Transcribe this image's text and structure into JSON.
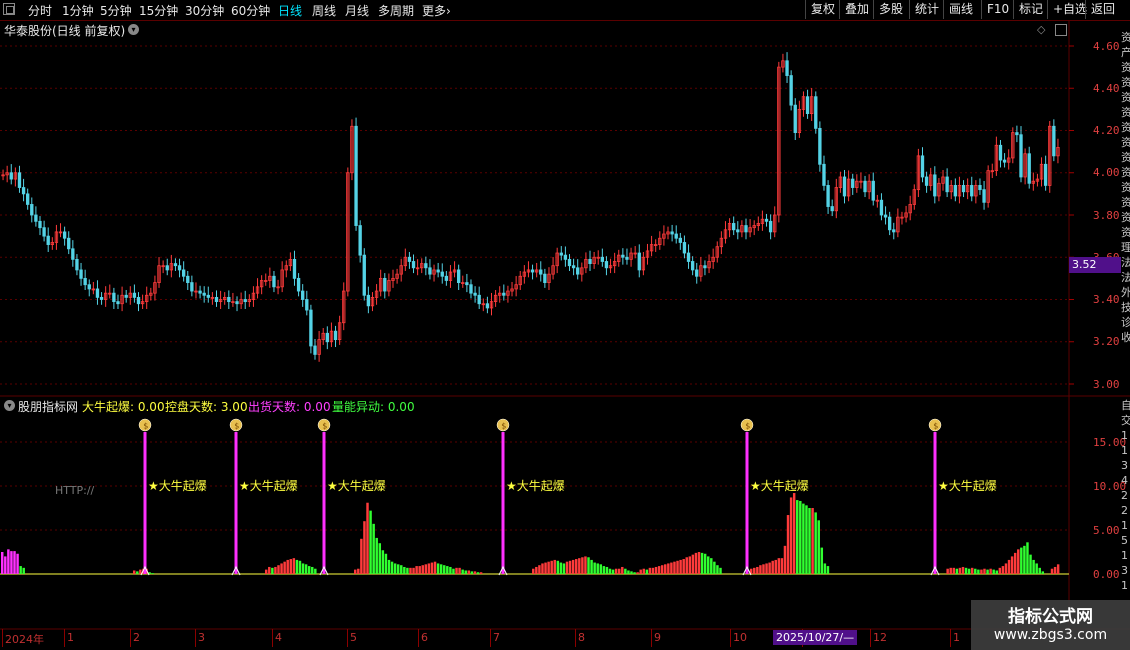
{
  "toolbar": {
    "periods": [
      {
        "label": "分时",
        "active": false
      },
      {
        "label": "1分钟",
        "active": false
      },
      {
        "label": "5分钟",
        "active": false
      },
      {
        "label": "15分钟",
        "active": false
      },
      {
        "label": "30分钟",
        "active": false
      },
      {
        "label": "60分钟",
        "active": false
      },
      {
        "label": "日线",
        "active": true
      },
      {
        "label": "周线",
        "active": false
      },
      {
        "label": "月线",
        "active": false
      },
      {
        "label": "多周期",
        "active": false
      },
      {
        "label": "更多",
        "active": false
      }
    ],
    "more_chevron": "›",
    "right_buttons": [
      "复权",
      "叠加",
      "多股",
      "统计",
      "画线",
      "F10",
      "标记",
      "+自选",
      "返回"
    ]
  },
  "main_chart": {
    "title": "华泰股份(日线 前复权)",
    "y_ticks": [
      "4.60",
      "4.40",
      "4.20",
      "4.00",
      "3.80",
      "3.60",
      "3.40",
      "3.20",
      "3.00"
    ],
    "current_price": "3.52"
  },
  "indicator": {
    "name": "股朋指标网",
    "values": [
      {
        "label": "大牛起爆: 0.00",
        "color": "#ffff40"
      },
      {
        "label": "控盘天数: 3.00",
        "color": "#ffff40"
      },
      {
        "label": "出货天数: 0.00",
        "color": "#ff40ff"
      },
      {
        "label": "量能异动: 0.00",
        "color": "#40ff40"
      }
    ],
    "y_ticks": [
      "15.00",
      "10.00",
      "5.00",
      "0.00"
    ],
    "signal_label": "★大牛起爆",
    "http_text": "HTTP://"
  },
  "x_axis": {
    "labels": [
      "2024年",
      "1",
      "2",
      "3",
      "4",
      "5",
      "6",
      "7",
      "8",
      "9",
      "10",
      "11",
      "12",
      "1"
    ],
    "date_tag": "2025/10/27/—"
  },
  "watermark": {
    "line1": "指标公式网",
    "line2": "www.zbgs3.com"
  },
  "colors": {
    "up": "#ff3b3b",
    "down": "#54d3e6",
    "grid": "#5a0000",
    "magenta": "#ff30ff",
    "green": "#30ff30",
    "yellow": "#ffff40"
  },
  "chart_data": [
    {
      "type": "candlestick",
      "title": "华泰股份(日线 前复权)",
      "ylim": [
        2.95,
        4.7
      ],
      "close": [
        3.99,
        4.0,
        3.97,
        4.0,
        3.93,
        3.9,
        3.85,
        3.8,
        3.77,
        3.74,
        3.7,
        3.66,
        3.67,
        3.72,
        3.72,
        3.69,
        3.64,
        3.59,
        3.54,
        3.5,
        3.47,
        3.45,
        3.45,
        3.41,
        3.4,
        3.43,
        3.43,
        3.39,
        3.38,
        3.42,
        3.41,
        3.43,
        3.41,
        3.38,
        3.39,
        3.42,
        3.43,
        3.48,
        3.56,
        3.56,
        3.54,
        3.57,
        3.56,
        3.54,
        3.51,
        3.48,
        3.44,
        3.44,
        3.43,
        3.42,
        3.41,
        3.41,
        3.39,
        3.4,
        3.41,
        3.39,
        3.39,
        3.38,
        3.4,
        3.39,
        3.4,
        3.43,
        3.46,
        3.49,
        3.49,
        3.51,
        3.46,
        3.46,
        3.54,
        3.56,
        3.59,
        3.5,
        3.44,
        3.4,
        3.35,
        3.18,
        3.14,
        3.21,
        3.24,
        3.2,
        3.25,
        3.21,
        3.29,
        3.44,
        4.0,
        4.22,
        3.75,
        3.61,
        3.42,
        3.37,
        3.41,
        3.44,
        3.5,
        3.44,
        3.49,
        3.5,
        3.52,
        3.56,
        3.6,
        3.58,
        3.55,
        3.55,
        3.57,
        3.55,
        3.52,
        3.54,
        3.53,
        3.51,
        3.49,
        3.53,
        3.54,
        3.48,
        3.48,
        3.47,
        3.43,
        3.42,
        3.38,
        3.38,
        3.36,
        3.39,
        3.42,
        3.43,
        3.42,
        3.44,
        3.45,
        3.47,
        3.51,
        3.53,
        3.54,
        3.53,
        3.54,
        3.52,
        3.48,
        3.52,
        3.56,
        3.62,
        3.61,
        3.59,
        3.56,
        3.55,
        3.52,
        3.55,
        3.59,
        3.57,
        3.6,
        3.6,
        3.58,
        3.55,
        3.56,
        3.58,
        3.61,
        3.6,
        3.59,
        3.62,
        3.62,
        3.54,
        3.6,
        3.63,
        3.66,
        3.66,
        3.69,
        3.71,
        3.72,
        3.71,
        3.69,
        3.67,
        3.62,
        3.58,
        3.54,
        3.51,
        3.56,
        3.55,
        3.58,
        3.6,
        3.65,
        3.69,
        3.73,
        3.76,
        3.73,
        3.72,
        3.75,
        3.72,
        3.74,
        3.75,
        3.76,
        3.78,
        3.77,
        3.72,
        3.8,
        4.5,
        4.53,
        4.46,
        4.32,
        4.19,
        4.3,
        4.36,
        4.28,
        4.36,
        4.21,
        4.04,
        3.94,
        3.84,
        3.82,
        3.93,
        3.98,
        3.89,
        3.97,
        3.93,
        3.96,
        3.96,
        3.91,
        3.96,
        3.87,
        3.87,
        3.8,
        3.79,
        3.73,
        3.72,
        3.79,
        3.79,
        3.81,
        3.85,
        3.92,
        4.08,
        3.98,
        3.94,
        3.99,
        3.89,
        3.95,
        3.98,
        3.91,
        3.94,
        3.89,
        3.94,
        3.91,
        3.94,
        3.89,
        3.94,
        3.92,
        3.86,
        4.01,
        4.01,
        4.13,
        4.06,
        4.05,
        4.07,
        4.19,
        4.18,
        3.98,
        4.09,
        3.95,
        3.96,
        3.97,
        4.04,
        3.94,
        4.22,
        4.08,
        4.12
      ],
      "yaxis_ticks": [
        4.6,
        4.4,
        4.2,
        4.0,
        3.8,
        3.6,
        3.4,
        3.2,
        3.0
      ]
    },
    {
      "type": "bar",
      "title": "股朋指标网",
      "ylim": [
        0,
        19
      ],
      "values": [
        2.5,
        2.0,
        2.8,
        2.6,
        2.6,
        2.3,
        0.9,
        0.7,
        0,
        0,
        0,
        0,
        0,
        0,
        0,
        0,
        0,
        0,
        0,
        0,
        0,
        0,
        0,
        0,
        0,
        0,
        0,
        0,
        0,
        0,
        0,
        0,
        0,
        0,
        0,
        0,
        0,
        0,
        0,
        0,
        0,
        0,
        0,
        0.4,
        0.3,
        0.5,
        0.6,
        0.6,
        0.2,
        0.1,
        0,
        0,
        0,
        0,
        0,
        0,
        0,
        0,
        0,
        0,
        0,
        0,
        0,
        0,
        0,
        0,
        0,
        0,
        0,
        0,
        0,
        0,
        0,
        0,
        0,
        0,
        0,
        0,
        0,
        0,
        0,
        0,
        0,
        0,
        0,
        0,
        0.5,
        0.8,
        0.7,
        0.8,
        1.0,
        1.2,
        1.4,
        1.6,
        1.7,
        1.8,
        1.6,
        1.5,
        1.2,
        1.1,
        0.9,
        0.8,
        0.6,
        0,
        0,
        0,
        0,
        0,
        0,
        0,
        0,
        0,
        0,
        0,
        0,
        0.5,
        0.6,
        4.0,
        6.0,
        8.1,
        7.2,
        5.7,
        4.1,
        3.5,
        2.7,
        2.3,
        1.6,
        1.4,
        1.2,
        1.1,
        1.0,
        0.8,
        0.7,
        0.7,
        0.7,
        0.9,
        0.9,
        1.0,
        1.1,
        1.2,
        1.3,
        1.4,
        1.2,
        1.1,
        1.0,
        0.9,
        0.8,
        0.6,
        0.7,
        0.7,
        0.5,
        0.4,
        0.4,
        0.3,
        0.3,
        0.2,
        0.2,
        0,
        0,
        0,
        0,
        0,
        0,
        0,
        0,
        0,
        0,
        0,
        0,
        0,
        0,
        0,
        0,
        0.6,
        0.8,
        1.0,
        1.2,
        1.3,
        1.4,
        1.5,
        1.6,
        1.5,
        1.3,
        1.2,
        1.4,
        1.5,
        1.6,
        1.7,
        1.8,
        1.9,
        2.0,
        1.9,
        1.6,
        1.3,
        1.2,
        1.1,
        0.9,
        0.8,
        0.6,
        0.5,
        0.6,
        0.6,
        0.8,
        0.6,
        0.4,
        0.3,
        0.2,
        0.2,
        0.5,
        0.6,
        0.5,
        0.7,
        0.7,
        0.8,
        0.9,
        1.0,
        1.1,
        1.2,
        1.3,
        1.4,
        1.5,
        1.6,
        1.7,
        1.9,
        2.0,
        2.2,
        2.4,
        2.5,
        2.4,
        2.3,
        2.0,
        1.8,
        1.4,
        1.0,
        0.7,
        0,
        0,
        0,
        0,
        0,
        0,
        0,
        0,
        0,
        0.6,
        0.7,
        0.8,
        1.0,
        1.1,
        1.2,
        1.3,
        1.5,
        1.6,
        1.8,
        1.8,
        3.2,
        6.7,
        8.7,
        9.2,
        8.4,
        8.3,
        8.0,
        7.8,
        7.5,
        7.5,
        7.0,
        6.1,
        3.0,
        1.2,
        0.9,
        0,
        0,
        0,
        0,
        0,
        0,
        0,
        0,
        0,
        0,
        0,
        0,
        0,
        0,
        0,
        0,
        0,
        0,
        0,
        0,
        0,
        0,
        0,
        0,
        0,
        0,
        0,
        0,
        0,
        0,
        0,
        0,
        0,
        0,
        0,
        0,
        0,
        0,
        0.6,
        0.7,
        0.7,
        0.6,
        0.7,
        0.8,
        0.7,
        0.6,
        0.7,
        0.6,
        0.5,
        0.5,
        0.6,
        0.5,
        0.6,
        0.5,
        0.4,
        0.7,
        0.9,
        1.2,
        1.6,
        2.0,
        2.4,
        2.8,
        3.0,
        3.2,
        3.6,
        2.2,
        1.6,
        1.2,
        0.7,
        0.3,
        0,
        0,
        0.6,
        0.8,
        1.1
      ],
      "signal_indices": [
        40,
        62,
        84,
        136,
        200,
        251
      ]
    }
  ]
}
